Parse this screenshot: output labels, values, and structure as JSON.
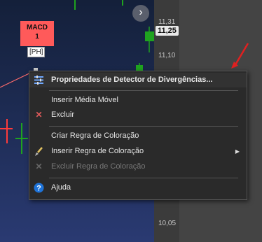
{
  "chart": {
    "price_ticks": [
      "11,31",
      "11,10",
      "10,05"
    ],
    "current_price": "11,25",
    "nav_label": "›"
  },
  "macd_flag": {
    "title": "MACD",
    "count": "1"
  },
  "ph_label": "[PH]",
  "context_menu": {
    "items": [
      {
        "label": "Propriedades de Detector de Divergências...",
        "icon": "properties-icon",
        "bold": true
      },
      {
        "label": "Inserir Média Móvel",
        "icon": ""
      },
      {
        "label": "Excluir",
        "icon": "delete-x-icon"
      },
      {
        "label": "Criar Regra de Coloração",
        "icon": ""
      },
      {
        "label": "Inserir Regra de Coloração",
        "icon": "paint-brush-icon",
        "submenu": true
      },
      {
        "label": "Excluir Regra de Coloração",
        "icon": "delete-x-disabled-icon",
        "disabled": true
      },
      {
        "label": "Ajuda",
        "icon": "help-icon"
      }
    ]
  },
  "colors": {
    "accent_red": "#ff5a5a",
    "candle_green": "#1fa31f",
    "help_blue": "#1e73d8"
  }
}
